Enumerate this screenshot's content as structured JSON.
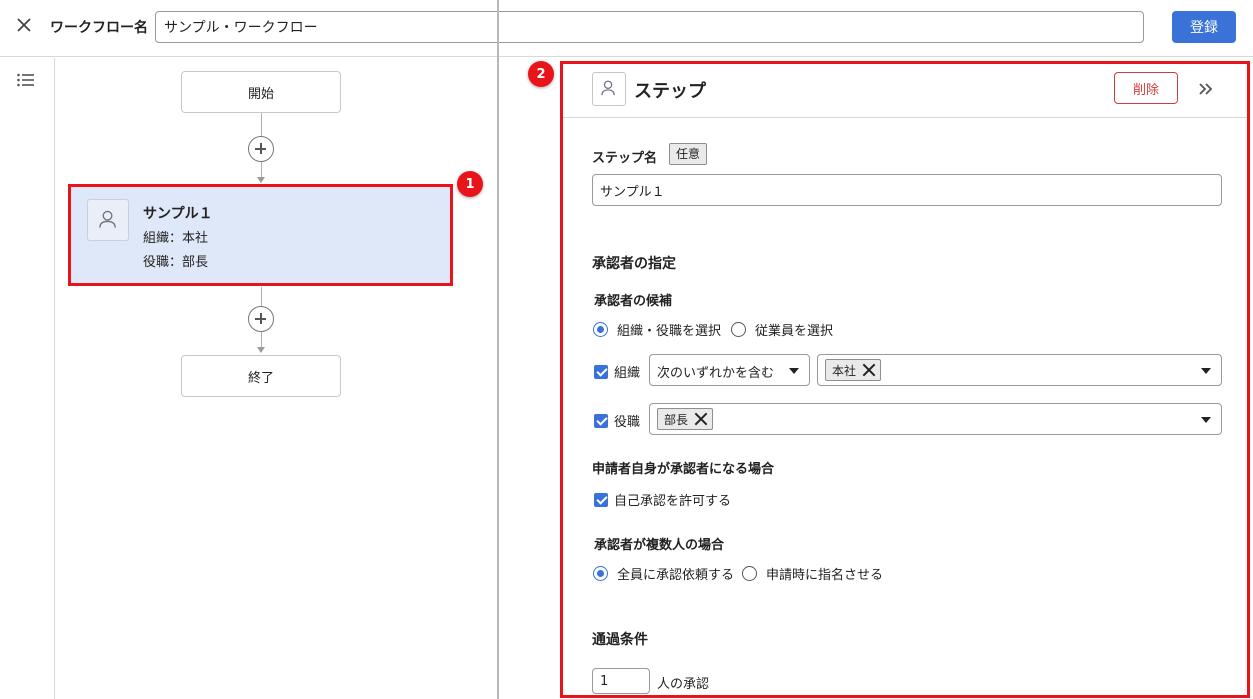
{
  "header": {
    "workflow_label": "ワークフロー名",
    "workflow_name": "サンプル・ワークフロー",
    "register_label": "登録"
  },
  "flow": {
    "start_label": "開始",
    "end_label": "終了",
    "step": {
      "title": "サンプル１",
      "org_line": "組織：本社",
      "position_line": "役職：部長"
    }
  },
  "badges": [
    "1",
    "2"
  ],
  "panel": {
    "title": "ステップ",
    "delete_label": "削除",
    "step_name_label": "ステップ名",
    "optional_tag": "任意",
    "step_name_value": "サンプル１",
    "approver_section": "承認者の指定",
    "candidate_label": "承認者の候補",
    "candidate_options": [
      "組織・役職を選択",
      "従業員を選択"
    ],
    "candidate_selected": "組織・役職を選択",
    "org_label": "組織",
    "org_match": "次のいずれかを含む",
    "org_chip": "本社",
    "position_label": "役職",
    "position_chip": "部長",
    "self_section": "申請者自身が承認者になる場合",
    "self_allow_label": "自己承認を許可する",
    "multi_section": "承認者が複数人の場合",
    "multi_options": [
      "全員に承認依頼する",
      "申請時に指名させる"
    ],
    "multi_selected": "全員に承認依頼する",
    "pass_section": "通過条件",
    "pass_count": "1",
    "pass_suffix": "人の承認"
  },
  "colors": {
    "accent": "#3a72d8",
    "highlight": "#e8141a",
    "danger": "#d33b3b",
    "selected_card": "#dfe8f8"
  }
}
